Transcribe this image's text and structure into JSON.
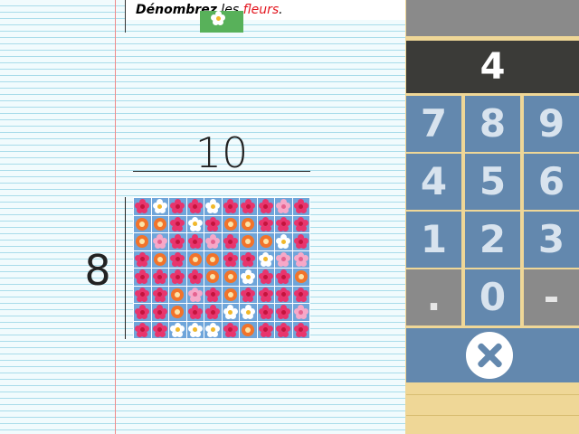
{
  "instruction": {
    "verb": "Dénombrez",
    "rest": " les ",
    "object": "fleurs",
    "end": "."
  },
  "colors": {
    "accent_red": "#e3161f",
    "paper_line": "#a9dcea",
    "margin": "#ef8b8b",
    "key_blue": "#6388ae",
    "key_gray": "#8a8a8a"
  },
  "problem": {
    "columns": "10",
    "rows": "8"
  },
  "flowers": {
    "legend": {
      "P": "pink-flower",
      "O": "orange-ring-flower",
      "W": "white-daisy",
      "L": "light-pink-flower"
    },
    "grid": [
      "PWPPWPPPLP",
      "OOPWPOOPPP",
      "OLPPLPOOWP",
      "POPOOPPWLL",
      "PPPPOOWPPO",
      "PPOLPOPPPP",
      "PPOPPWWPPL",
      "PPWWWPOPPP"
    ]
  },
  "keypad": {
    "display_value": "4",
    "blank_display": "",
    "rows": [
      [
        "7",
        "8",
        "9"
      ],
      [
        "4",
        "5",
        "6"
      ],
      [
        "1",
        "2",
        "3"
      ],
      [
        ".",
        "0",
        "-"
      ]
    ],
    "clear_icon": "clear-x-icon"
  }
}
